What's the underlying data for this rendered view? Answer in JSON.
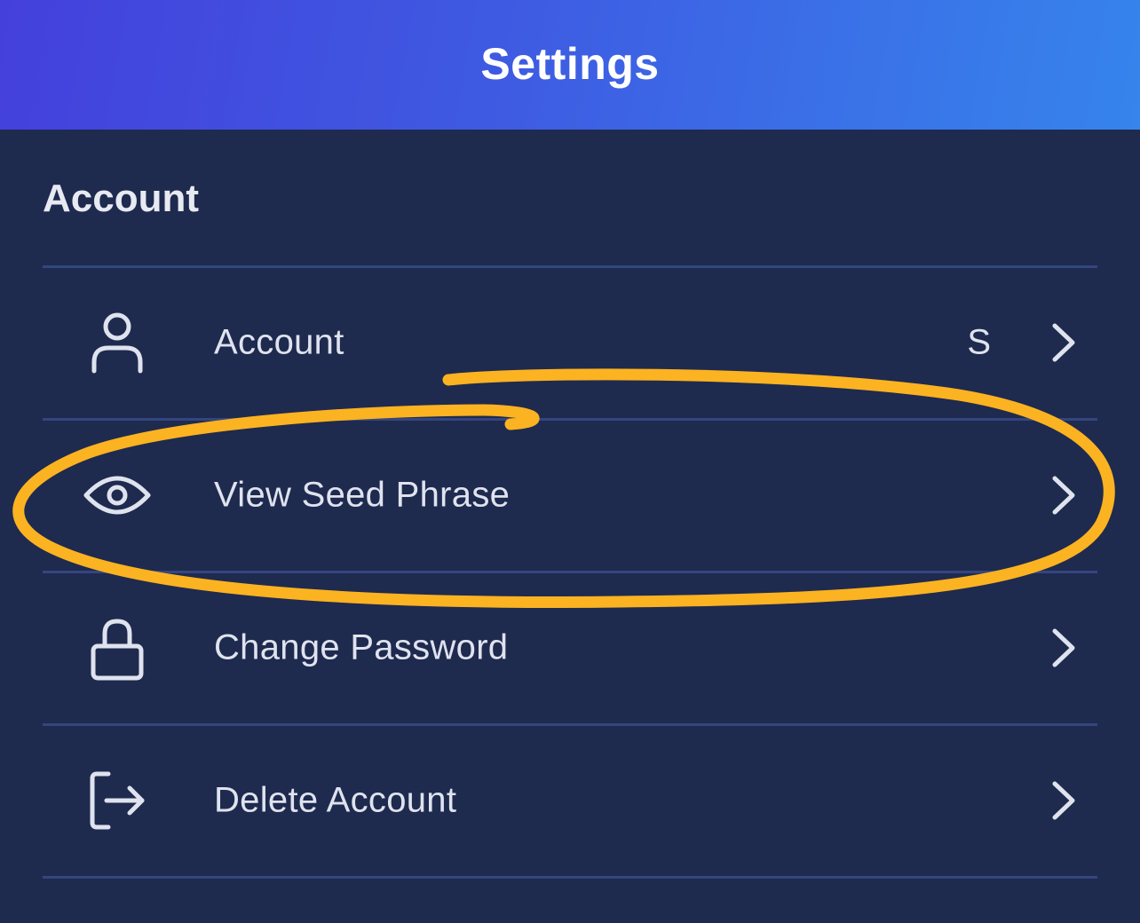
{
  "header": {
    "title": "Settings"
  },
  "section": {
    "title": "Account"
  },
  "rows": [
    {
      "label": "Account",
      "value": "S",
      "icon": "user-icon"
    },
    {
      "label": "View Seed Phrase",
      "value": "",
      "icon": "eye-icon"
    },
    {
      "label": "Change Password",
      "value": "",
      "icon": "lock-icon"
    },
    {
      "label": "Delete Account",
      "value": "",
      "icon": "logout-icon"
    }
  ],
  "colors": {
    "header_gradient_start": "#4440dc",
    "header_gradient_end": "#3684ec",
    "background": "#1f2a4f",
    "divider": "#34467f",
    "text": "#dfe3ee",
    "highlight": "#fbb321"
  }
}
